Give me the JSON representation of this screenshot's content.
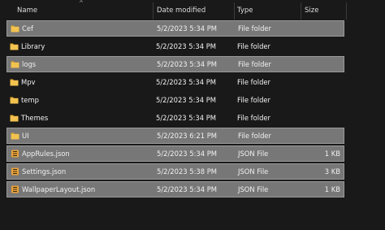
{
  "header": {
    "name_label": "Name",
    "date_label": "Date modified",
    "type_label": "Type",
    "size_label": "Size",
    "sort_glyph": "^"
  },
  "files": [
    {
      "name": "Cef",
      "date": "5/2/2023 5:34 PM",
      "type": "File folder",
      "size": "",
      "icon": "folder-icon",
      "selected": true
    },
    {
      "name": "Library",
      "date": "5/2/2023 5:34 PM",
      "type": "File folder",
      "size": "",
      "icon": "folder-icon",
      "selected": false
    },
    {
      "name": "logs",
      "date": "5/2/2023 5:34 PM",
      "type": "File folder",
      "size": "",
      "icon": "folder-icon",
      "selected": true
    },
    {
      "name": "Mpv",
      "date": "5/2/2023 5:34 PM",
      "type": "File folder",
      "size": "",
      "icon": "folder-icon",
      "selected": false
    },
    {
      "name": "temp",
      "date": "5/2/2023 5:34 PM",
      "type": "File folder",
      "size": "",
      "icon": "folder-icon",
      "selected": false
    },
    {
      "name": "Themes",
      "date": "5/2/2023 5:34 PM",
      "type": "File folder",
      "size": "",
      "icon": "folder-icon",
      "selected": false
    },
    {
      "name": "UI",
      "date": "5/2/2023 6:21 PM",
      "type": "File folder",
      "size": "",
      "icon": "folder-icon",
      "selected": true
    },
    {
      "name": "AppRules.json",
      "date": "5/2/2023 5:34 PM",
      "type": "JSON File",
      "size": "1 KB",
      "icon": "json-file-icon",
      "selected": true
    },
    {
      "name": "Settings.json",
      "date": "5/2/2023 5:38 PM",
      "type": "JSON File",
      "size": "3 KB",
      "icon": "json-file-icon",
      "selected": true
    },
    {
      "name": "WallpaperLayout.json",
      "date": "5/2/2023 5:34 PM",
      "type": "JSON File",
      "size": "1 KB",
      "icon": "json-file-icon",
      "selected": true
    }
  ],
  "colors": {
    "background": "#191919",
    "selection": "#777777",
    "folder": "#f2c24f",
    "json_icon": "#e8a23a"
  }
}
